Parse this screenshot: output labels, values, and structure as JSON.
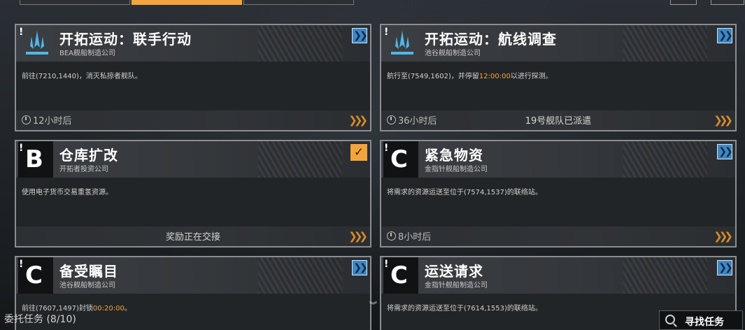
{
  "bottom": {
    "mission_count_label": "委托任务 (8/10)",
    "find_button_label": "寻找任务"
  },
  "cards": [
    {
      "title": "开拓运动：联手行动",
      "company": "BEA舰船制造公司",
      "desc": "前往(7210,1440)，消灭私掠者舰队。",
      "timer": "12小时后",
      "status": "",
      "action_icon": "double-chevron-right-icon"
    },
    {
      "title": "开拓运动：航线调查",
      "company": "池谷舰船制造公司",
      "desc_pre": "航行至(7549,1602)，并停留",
      "desc_hl": "12:00:00",
      "desc_post": "以进行探测。",
      "timer": "36小时后",
      "status": "19号舰队已派遣",
      "action_icon": "double-chevron-right-icon"
    },
    {
      "grade": "B",
      "title": "仓库扩改",
      "company": "开拓者投资公司",
      "desc": "使用电子货币交易重氢资源。",
      "timer": "",
      "status": "奖励正在交接",
      "action_icon": "check-icon"
    },
    {
      "grade": "C",
      "title": "紧急物资",
      "company": "金指针舰船制造公司",
      "desc": "将需求的资源运送至位于(7574,1537)的联络站。",
      "timer": "8小时后",
      "status": "",
      "action_icon": "double-chevron-right-icon"
    },
    {
      "grade": "C",
      "title": "备受瞩目",
      "company": "池谷舰船制造公司",
      "desc_pre": "前往(7607,1497)封锁",
      "desc_hl": "00:20:00",
      "desc_post": "。",
      "action_icon": "double-chevron-right-icon"
    },
    {
      "grade": "C",
      "title": "运送请求",
      "company": "金指针舰船制造公司",
      "desc": "将需求的资源运送至位于(7614,1553)的联络站。",
      "action_icon": "double-chevron-right-icon"
    }
  ],
  "colors": {
    "accent_orange": "#f2a53c",
    "action_blue": "#3f86c4",
    "emblem_blue": "#4fb8e8"
  }
}
